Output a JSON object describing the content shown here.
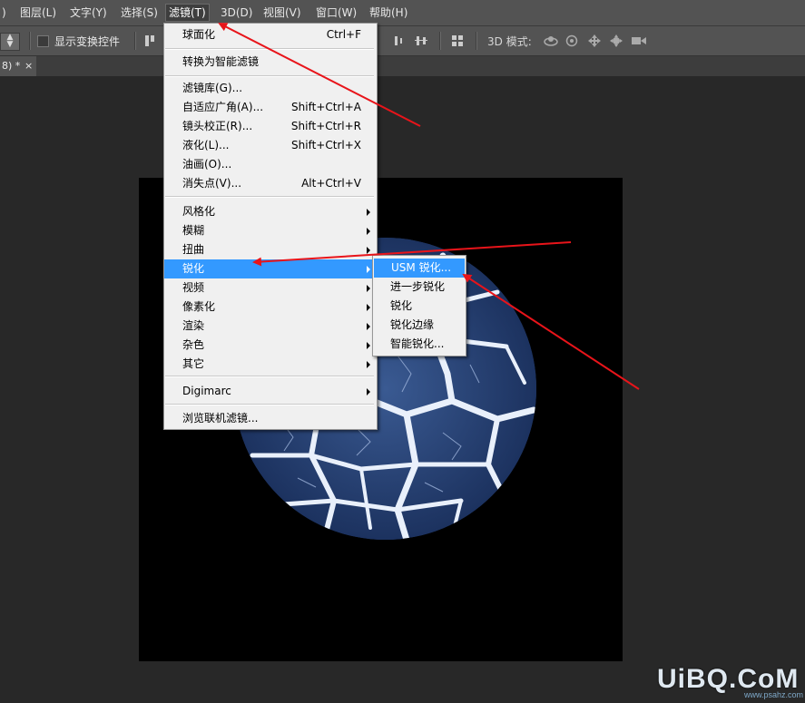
{
  "menubar": {
    "items": [
      {
        "label": ")"
      },
      {
        "label": "图层(L)"
      },
      {
        "label": "文字(Y)"
      },
      {
        "label": "选择(S)"
      },
      {
        "label": "滤镜(T)"
      },
      {
        "label": "3D(D)"
      },
      {
        "label": "视图(V)"
      },
      {
        "label": "窗口(W)"
      },
      {
        "label": "帮助(H)"
      }
    ]
  },
  "options": {
    "show_transform_label": "显示变换控件",
    "mode_3d_label": "3D 模式:"
  },
  "document_tab": {
    "title": "8) *",
    "close": "×"
  },
  "filter_menu": {
    "items": [
      {
        "label": "球面化",
        "shortcut": "Ctrl+F"
      },
      {
        "label": "转换为智能滤镜",
        "shortcut": ""
      },
      {
        "label": "滤镜库(G)...",
        "shortcut": ""
      },
      {
        "label": "自适应广角(A)...",
        "shortcut": "Shift+Ctrl+A"
      },
      {
        "label": "镜头校正(R)...",
        "shortcut": "Shift+Ctrl+R"
      },
      {
        "label": "液化(L)...",
        "shortcut": "Shift+Ctrl+X"
      },
      {
        "label": "油画(O)...",
        "shortcut": ""
      },
      {
        "label": "消失点(V)...",
        "shortcut": "Alt+Ctrl+V"
      },
      {
        "label": "风格化",
        "shortcut": ""
      },
      {
        "label": "模糊",
        "shortcut": ""
      },
      {
        "label": "扭曲",
        "shortcut": ""
      },
      {
        "label": "锐化",
        "shortcut": ""
      },
      {
        "label": "视频",
        "shortcut": ""
      },
      {
        "label": "像素化",
        "shortcut": ""
      },
      {
        "label": "渲染",
        "shortcut": ""
      },
      {
        "label": "杂色",
        "shortcut": ""
      },
      {
        "label": "其它",
        "shortcut": ""
      },
      {
        "label": "Digimarc",
        "shortcut": ""
      },
      {
        "label": "浏览联机滤镜...",
        "shortcut": ""
      }
    ]
  },
  "sharpen_submenu": {
    "items": [
      {
        "label": "USM 锐化..."
      },
      {
        "label": "进一步锐化"
      },
      {
        "label": "锐化"
      },
      {
        "label": "锐化边缘"
      },
      {
        "label": "智能锐化..."
      }
    ]
  },
  "watermark": {
    "text": "UiBQ.CoM",
    "sub": "www.psahz.com"
  },
  "colors": {
    "highlight": "#3399ff",
    "annotation_arrow": "#e8141a",
    "panel": "#535353",
    "workspace": "#282828"
  }
}
